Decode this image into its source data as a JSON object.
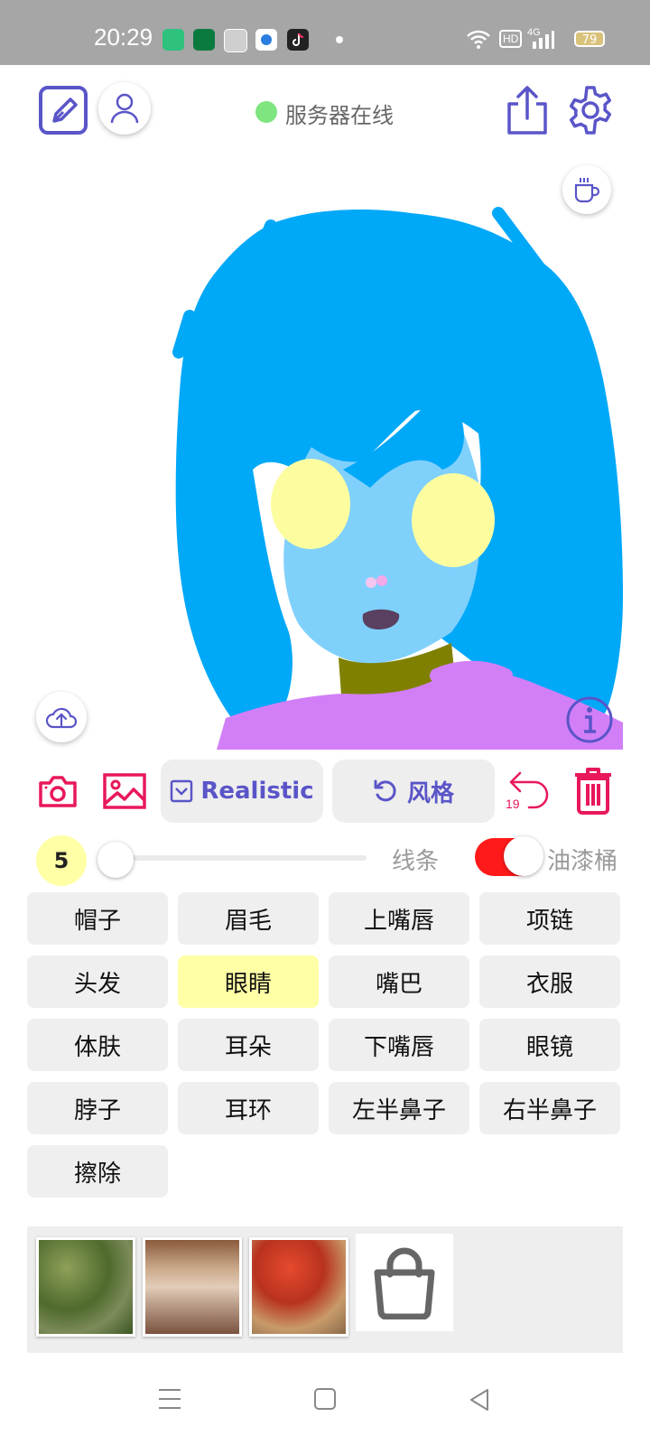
{
  "status_bar": {
    "time": "20:29",
    "hd": "HD",
    "network": "4G",
    "battery": "79",
    "app_icons": [
      "android-app-icon",
      "oppo-app-icon",
      "baidu-app-icon",
      "browser-app-icon",
      "tiktok-app-icon"
    ]
  },
  "header": {
    "server_status": "服务器在线",
    "server_status_color": "#7fe57f",
    "accent_color": "#5a55c8"
  },
  "toolbar": {
    "model_label": "Realistic",
    "style_label": "风格",
    "undo_count": "19",
    "accent_red": "#e8185a"
  },
  "brush": {
    "size": "5",
    "line_label": "线条",
    "fill_label": "油漆桶",
    "fill_enabled": true
  },
  "parts": [
    {
      "label": "帽子"
    },
    {
      "label": "眉毛"
    },
    {
      "label": "上嘴唇"
    },
    {
      "label": "项链"
    },
    {
      "label": "头发"
    },
    {
      "label": "眼睛"
    },
    {
      "label": "嘴巴"
    },
    {
      "label": "衣服"
    },
    {
      "label": "体肤"
    },
    {
      "label": "耳朵"
    },
    {
      "label": "下嘴唇"
    },
    {
      "label": "眼镜"
    },
    {
      "label": "脖子"
    },
    {
      "label": "耳环"
    },
    {
      "label": "左半鼻子"
    },
    {
      "label": "右半鼻子"
    },
    {
      "label": "擦除"
    }
  ],
  "selected_part": "眼睛",
  "drawing_colors": {
    "hair": "#00a8f8",
    "skin": "#80d0fc",
    "eyes": "#fdfda0",
    "neck": "#808000",
    "clothes": "#d27ff7",
    "mouth": "#5a4060",
    "nose": "#f3a8e8"
  }
}
